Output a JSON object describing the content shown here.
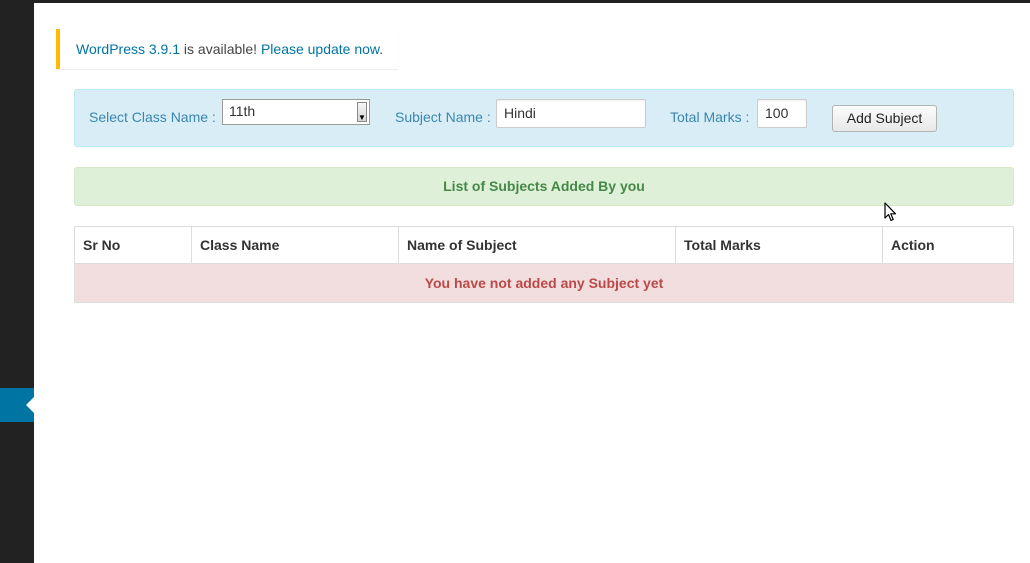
{
  "update_notice": {
    "version_link": "WordPress 3.9.1",
    "middle_text": " is available! ",
    "update_link": "Please update now",
    "trailing": "."
  },
  "form": {
    "class_label": "Select Class Name :",
    "class_selected": "11th",
    "subject_label": "Subject Name :",
    "subject_value": "Hindi",
    "marks_label": "Total Marks :",
    "marks_value": "100",
    "add_button": "Add Subject"
  },
  "list_header": "List of Subjects Added By you",
  "table": {
    "columns": [
      "Sr No",
      "Class Name",
      "Name of Subject",
      "Total Marks",
      "Action"
    ],
    "empty_message": "You have not added any Subject yet"
  },
  "colors": {
    "notice_border": "#ffba00",
    "link": "#0074a2",
    "info_bg": "#d9edf7",
    "success_bg": "#dff0d8",
    "danger_bg": "#f2dede"
  }
}
